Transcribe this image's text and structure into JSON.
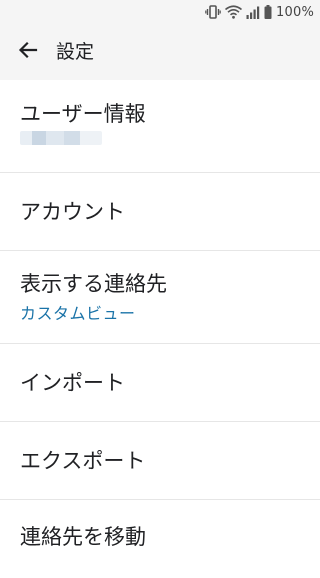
{
  "status_bar": {
    "battery_percent": "100%",
    "icons": [
      "vibrate-icon",
      "wifi-icon",
      "signal-icon",
      "battery-icon"
    ]
  },
  "app_bar": {
    "title": "設定",
    "back_icon": "arrow-back-icon"
  },
  "settings": {
    "items": [
      {
        "label": "ユーザー情報"
      },
      {
        "label": "アカウント"
      },
      {
        "label": "表示する連絡先",
        "sub": "カスタムビュー"
      },
      {
        "label": "インポート"
      },
      {
        "label": "エクスポート"
      },
      {
        "label": "連絡先を移動"
      }
    ]
  },
  "colors": {
    "accent": "#1a73a8",
    "app_bar_bg": "#f5f5f5",
    "divider": "#e6e6e6"
  }
}
